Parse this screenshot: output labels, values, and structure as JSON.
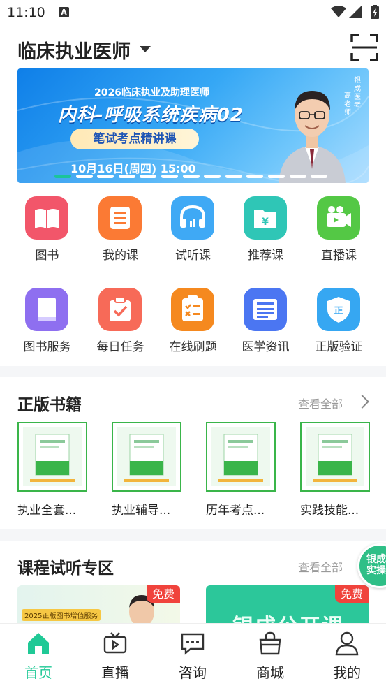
{
  "status_bar": {
    "time": "11:10",
    "notif_letter": "A"
  },
  "header": {
    "title": "临床执业医师",
    "scan_icon": "scan-icon"
  },
  "banner": {
    "subtitle": "2026临床执业及助理医师",
    "headline": "内科-呼吸系统疾病02",
    "pill": "笔试考点精讲课",
    "date": "10月16日(周四) 15:00",
    "side_text_1": "银成医考",
    "side_text_2": "高老师",
    "page_count": 13,
    "active_page": 1
  },
  "grid": [
    {
      "label": "图书",
      "icon": "book-open-icon",
      "color": "#f2566a"
    },
    {
      "label": "我的课",
      "icon": "list-doc-icon",
      "color": "#fb7a34"
    },
    {
      "label": "试听课",
      "icon": "headphones-icon",
      "color": "#3fa9f5"
    },
    {
      "label": "推荐课",
      "icon": "folder-yen-icon",
      "color": "#2fc6b6"
    },
    {
      "label": "直播课",
      "icon": "video-camera-icon",
      "color": "#54c845"
    },
    {
      "label": "图书服务",
      "icon": "book-service-icon",
      "color": "#8e6ff0"
    },
    {
      "label": "每日任务",
      "icon": "clipboard-check-icon",
      "color": "#f76a58"
    },
    {
      "label": "在线刷题",
      "icon": "quiz-list-icon",
      "color": "#f5891f"
    },
    {
      "label": "医学资讯",
      "icon": "news-icon",
      "color": "#4b76f2"
    },
    {
      "label": "正版验证",
      "icon": "shield-verify-icon",
      "color": "#36a7f2"
    }
  ],
  "books_section": {
    "title": "正版书籍",
    "more": "查看全部",
    "items": [
      {
        "label": "执业全套..."
      },
      {
        "label": "执业辅导..."
      },
      {
        "label": "历年考点..."
      },
      {
        "label": "实践技能..."
      }
    ]
  },
  "course_section": {
    "title": "课程试听专区",
    "more": "查看全部",
    "cards": [
      {
        "badge": "免费",
        "caption": "2025正版图书增值服务"
      },
      {
        "badge": "免费",
        "caption": "银成公开课"
      }
    ],
    "float_badge": "银成实操"
  },
  "tabbar": [
    {
      "label": "首页",
      "icon": "home-icon",
      "active": true
    },
    {
      "label": "直播",
      "icon": "tv-icon",
      "active": false
    },
    {
      "label": "咨询",
      "icon": "chat-icon",
      "active": false
    },
    {
      "label": "商城",
      "icon": "shopping-bag-icon",
      "active": false
    },
    {
      "label": "我的",
      "icon": "user-icon",
      "active": false
    }
  ]
}
